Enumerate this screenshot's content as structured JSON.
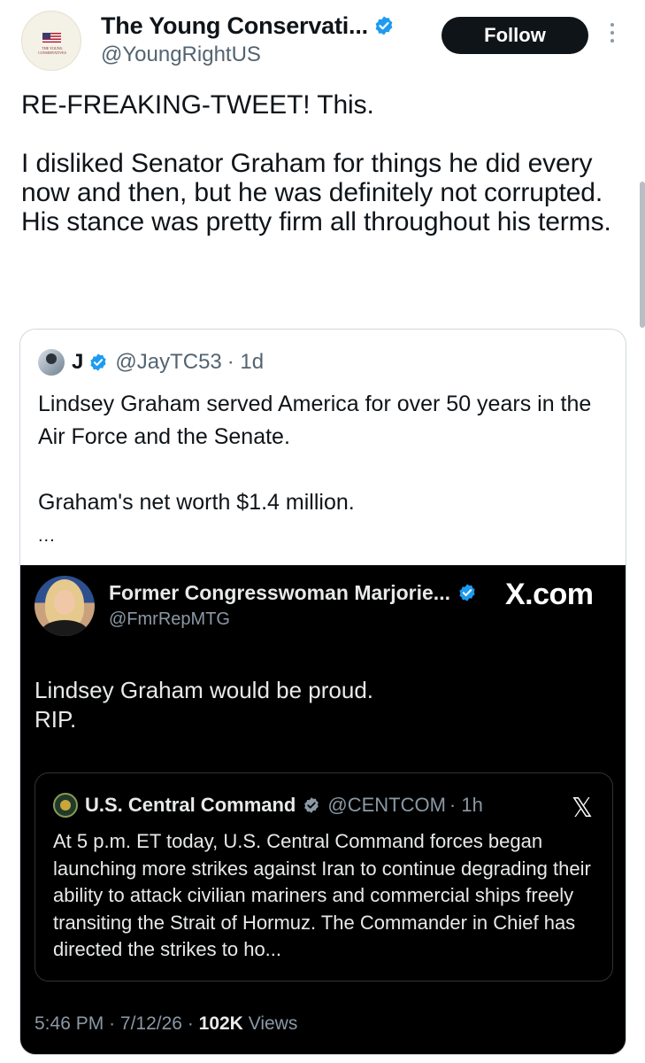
{
  "tweet": {
    "author_name": "The Young Conservati...",
    "author_handle": "@YoungRightUS",
    "avatar_caption": "THE YOUNG CONSERVATIVES",
    "follow_label": "Follow",
    "text": "RE-FREAKING-TWEET! This.\n\nI disliked Senator Graham for things he did every now and then, but he was definitely not corrupted. His stance was pretty firm all throughout his terms."
  },
  "quoted": {
    "author_name": "J",
    "author_handle": "@JayTC53",
    "age": "· 1d",
    "text": "Lindsey Graham served America for over 50 years in the Air Force and the Senate.\n\nGraham's net worth $1.4 million.",
    "ellipsis": "..."
  },
  "embedded": {
    "author_name": "Former Congresswoman Marjorie...",
    "author_handle": "@FmrRepMTG",
    "watermark": "X.com",
    "text": "Lindsey Graham would be proud.\nRIP.",
    "inner": {
      "author_name": "U.S. Central Command",
      "author_handle": "@CENTCOM",
      "age": "· 1h",
      "x_logo": "𝕏",
      "text": "At 5 p.m. ET today, U.S. Central Command forces began launching more strikes against Iran to continue degrading their ability to attack civilian mariners and commercial ships freely transiting the Strait of Hormuz. The Commander in Chief has directed the strikes to ho..."
    },
    "meta": {
      "time": "5:46 PM",
      "date": "7/12/26",
      "views_count": "102K",
      "views_label": "Views"
    }
  },
  "colors": {
    "verified_blue": "#1d9bf0",
    "text_primary": "#0f1419",
    "text_secondary": "#536471",
    "dark_bg": "#000000"
  },
  "icons": [
    "verified-badge-icon",
    "more-options-icon",
    "x-logo-icon"
  ]
}
